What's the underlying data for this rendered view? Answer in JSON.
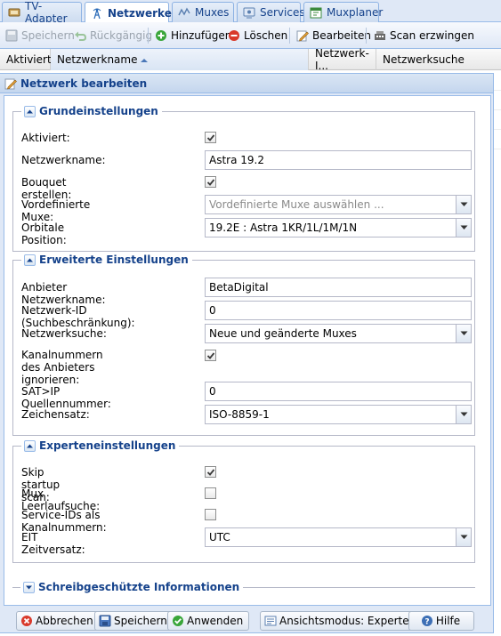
{
  "tabs": [
    {
      "label": "TV-Adapter",
      "icon": "tv-adapter-icon"
    },
    {
      "label": "Netzwerke",
      "icon": "network-antenna-icon",
      "active": true
    },
    {
      "label": "Muxes",
      "icon": "muxes-icon"
    },
    {
      "label": "Services",
      "icon": "services-icon"
    },
    {
      "label": "Muxplaner",
      "icon": "muxplaner-icon"
    }
  ],
  "toolbar": {
    "save_label": "Speichern",
    "undo_label": "Rückgängig",
    "add_label": "Hinzufügen",
    "delete_label": "Löschen",
    "edit_label": "Bearbeiten",
    "force_scan_label": "Scan erzwingen"
  },
  "grid": {
    "columns": [
      "Aktiviert",
      "Netzwerkname",
      "Netzwerk-I...",
      "Netzwerksuche"
    ],
    "sort_column": "Netzwerkname",
    "sort_direction": "ascending"
  },
  "dialog": {
    "title": "Netzwerk bearbeiten",
    "sections": {
      "basic": {
        "title": "Grundeinstellungen",
        "enabled_label": "Aktiviert:",
        "enabled": true,
        "name_label": "Netzwerkname:",
        "name_value": "Astra 19.2",
        "bouquet_label": "Bouquet erstellen:",
        "bouquet": true,
        "predefined_label": "Vordefinierte Muxe:",
        "predefined_placeholder": "Vordefinierte Muxe auswählen ...",
        "orbital_label": "Orbitale Position:",
        "orbital_value": "19.2E : Astra 1KR/1L/1M/1N"
      },
      "advanced": {
        "title": "Erweiterte Einstellungen",
        "provider_label": "Anbieter Netzwerkname:",
        "provider_value": "BetaDigital",
        "network_id_label": "Netzwerk-ID (Suchbeschränkung):",
        "network_id_value": "0",
        "discovery_label": "Netzwerksuche:",
        "discovery_value": "Neue und geänderte Muxes",
        "ignore_lcn_label_1": "Kanalnummern des Anbieters",
        "ignore_lcn_label_2": "ignorieren:",
        "ignore_lcn": true,
        "satip_label": "SAT>IP Quellennummer:",
        "satip_value": "0",
        "charset_label": "Zeichensatz:",
        "charset_value": "ISO-8859-1"
      },
      "expert": {
        "title": "Experteneinstellungen",
        "skip_scan_label": "Skip startup scan:",
        "skip_scan": true,
        "idle_scan_label": "Mux Leerlaufsuche:",
        "idle_scan": false,
        "sid_lcn_label": "Service-IDs als Kanalnummern:",
        "sid_lcn": false,
        "eit_label": "EIT Zeitversatz:",
        "eit_value": "UTC"
      },
      "readonly": {
        "title": "Schreibgeschützte Informationen"
      }
    },
    "buttons": {
      "cancel": "Abbrechen",
      "save": "Speichern",
      "apply": "Anwenden",
      "view_mode": "Ansichtsmodus: Experte",
      "help": "Hilfe"
    }
  },
  "colors": {
    "accent_text": "#15428b",
    "panel_bg": "#dfe8f6",
    "border": "#99bbe8"
  }
}
